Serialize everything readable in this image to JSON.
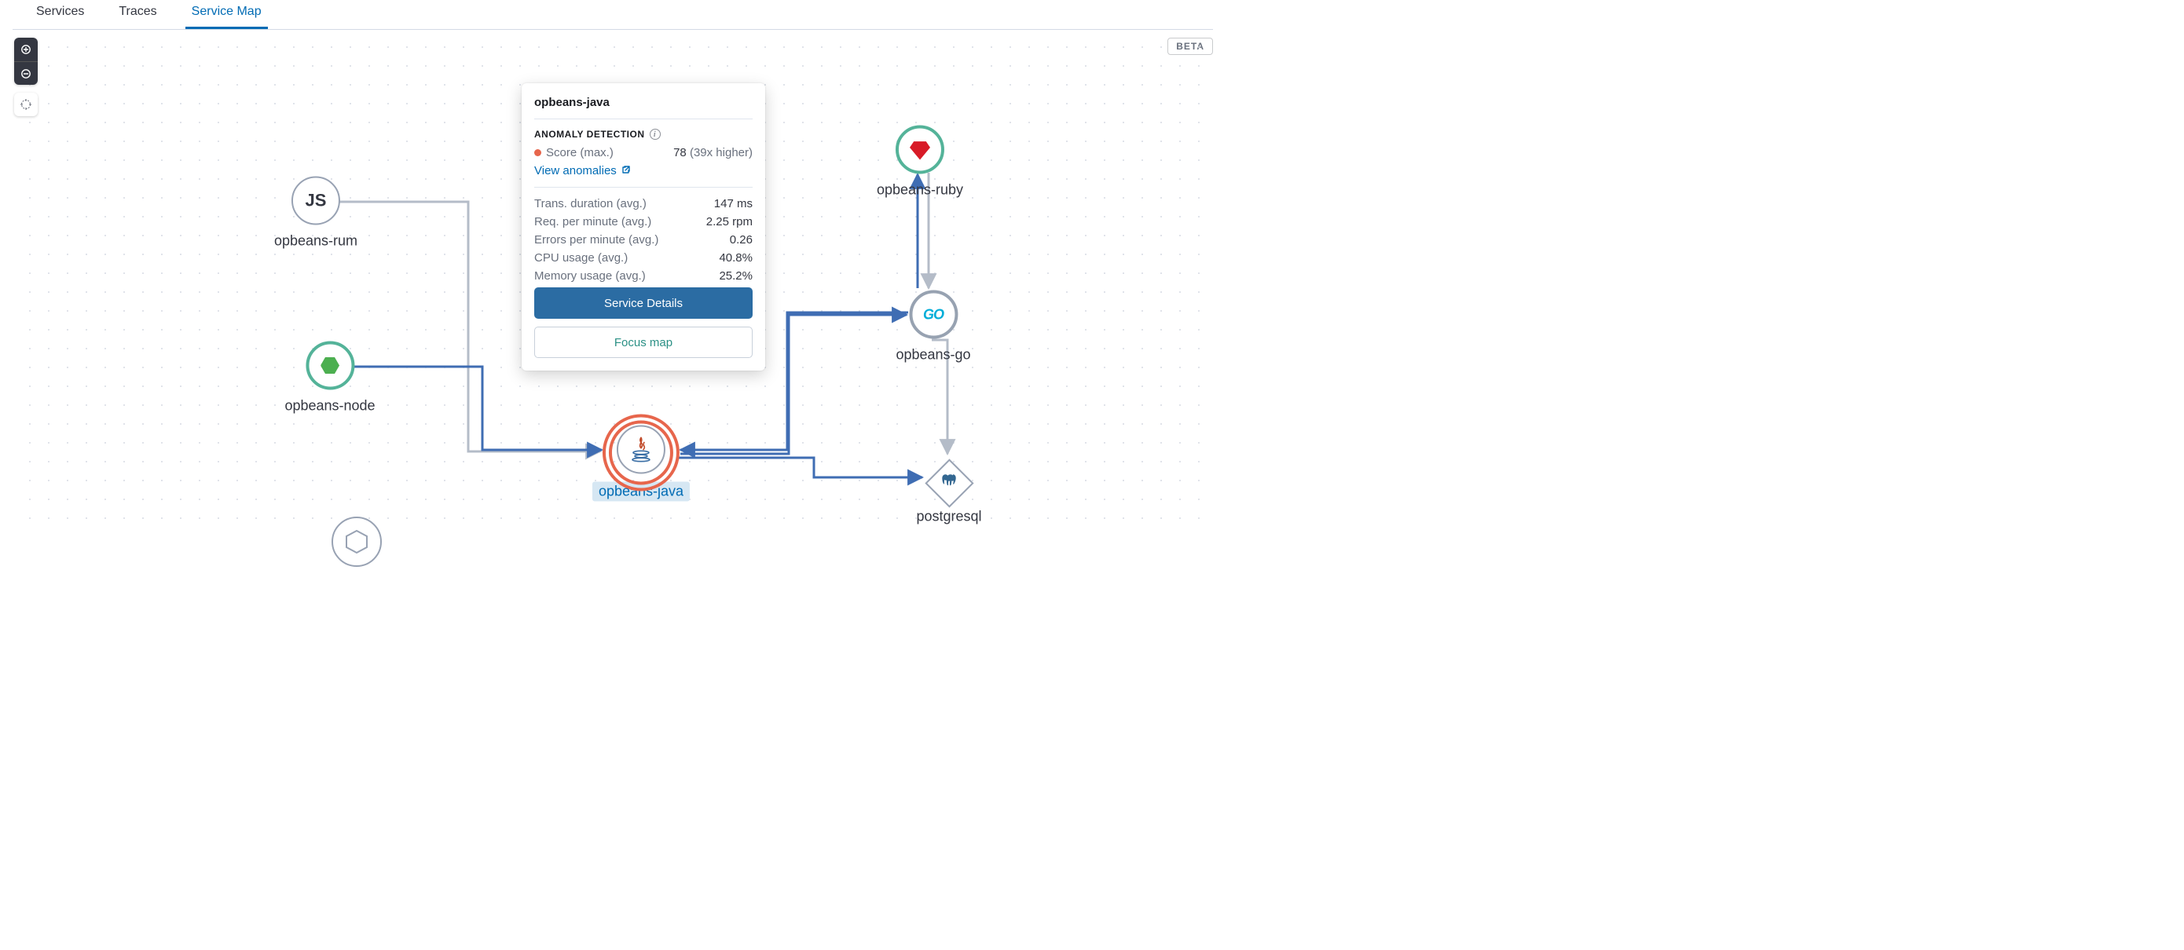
{
  "tabs": {
    "services": "Services",
    "traces": "Traces",
    "service_map": "Service Map"
  },
  "badge": "BETA",
  "nodes": {
    "rum": "opbeans-rum",
    "node": "opbeans-node",
    "java": "opbeans-java",
    "ruby": "opbeans-ruby",
    "go": "opbeans-go",
    "postgres": "postgresql"
  },
  "icons": {
    "js": "JS",
    "go": "GO"
  },
  "popover": {
    "title": "opbeans-java",
    "section": "ANOMALY DETECTION",
    "score_label": "Score (max.)",
    "score_val": "78",
    "score_comp": "(39x higher)",
    "view": "View anomalies",
    "metrics": [
      {
        "l": "Trans. duration (avg.)",
        "v": "147 ms"
      },
      {
        "l": "Req. per minute (avg.)",
        "v": "2.25 rpm"
      },
      {
        "l": "Errors per minute (avg.)",
        "v": "0.26"
      },
      {
        "l": "CPU usage (avg.)",
        "v": "40.8%"
      },
      {
        "l": "Memory usage (avg.)",
        "v": "25.2%"
      }
    ],
    "btn_primary": "Service Details",
    "btn_secondary": "Focus map"
  }
}
